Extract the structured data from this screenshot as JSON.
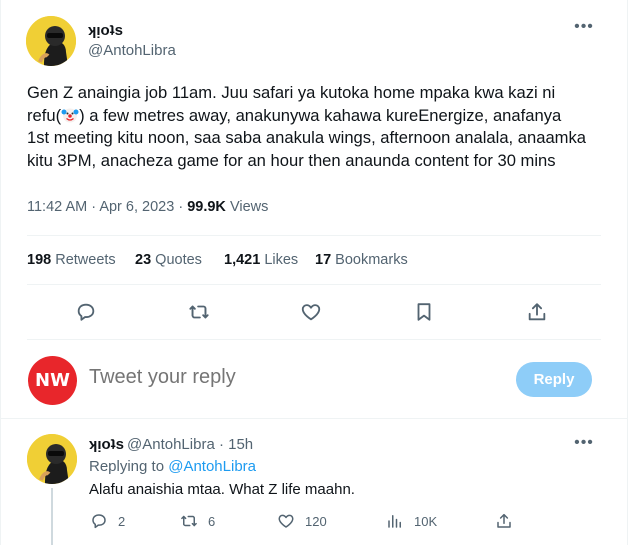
{
  "tweet": {
    "author": {
      "display_name": "ʞᴉoʇs",
      "handle": "@AntohLibra",
      "avatar_icon": "avatar-icon"
    },
    "text_before_emoji": "Gen Z anaingia job 11am. Juu safari ya kutoka home mpaka kwa kazi ni refu(",
    "emoji": "clown-face-emoji",
    "text_after_emoji": ") a few metres away, anakunywa kahawa kureEnergize, anafanya 1st meeting kitu noon, saa saba anakula wings, afternoon analala, anaamka kitu 3PM, anacheza game for an hour then anaunda content for 30 mins",
    "time": "11:42 AM",
    "date": "Apr 6, 2023",
    "views_count": "99.9K",
    "views_label": "Views",
    "separator": "·",
    "stats": {
      "retweets_count": "198",
      "retweets_label": "Retweets",
      "quotes_count": "23",
      "quotes_label": "Quotes",
      "likes_count": "1,421",
      "likes_label": "Likes",
      "bookmarks_count": "17",
      "bookmarks_label": "Bookmarks"
    },
    "actions": [
      "reply-icon",
      "retweet-icon",
      "like-icon",
      "bookmark-icon",
      "share-icon"
    ]
  },
  "composer": {
    "avatar_text": "NW",
    "avatar_color": "#e8262b",
    "placeholder": "Tweet your reply",
    "reply_button": "Reply",
    "reply_button_color": "#8ecdf8"
  },
  "reply": {
    "display_name": "ʞᴉoʇs",
    "handle_time": "@AntohLibra · 15h",
    "replying_to_label": "Replying to",
    "replying_to_handle": "@AntohLibra",
    "text": "Alafu anaishia mtaa. What Z life maahn.",
    "reply_count": "2",
    "retweet_count": "6",
    "like_count": "120",
    "views_count": "10K"
  },
  "colors": {
    "text": "#0f1419",
    "secondary": "#536471",
    "link": "#1d9bf0",
    "divider": "#eff3f4"
  }
}
